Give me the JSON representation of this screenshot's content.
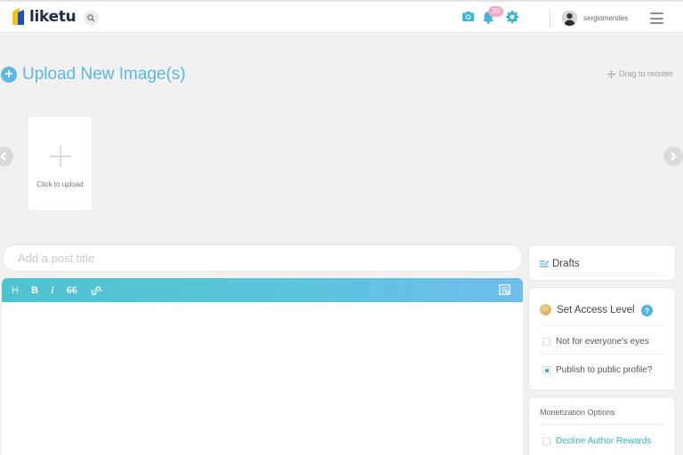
{
  "header": {
    "logo_text": "liketu",
    "notification_count": "30",
    "username": "sergiomendes"
  },
  "upload": {
    "title": "Upload New Image(s)",
    "drag_hint": "Drag to reorder",
    "tile_label": "Click to upload"
  },
  "post": {
    "title_placeholder": "Add a post title"
  },
  "toolbar": {
    "heading": "H",
    "bold": "B",
    "italic": "I",
    "quote": "66"
  },
  "sidebar": {
    "drafts_label": "Drafts",
    "access_title": "Set Access Level",
    "help_label": "?",
    "access_options": [
      {
        "label": "Not for everyone's eyes",
        "checked": false
      },
      {
        "label": "Publish to public profile?",
        "checked": true
      }
    ],
    "monetization_title": "Monetization Options",
    "monetization_options": [
      {
        "label": "Decline Author Rewards",
        "checked": false
      }
    ]
  },
  "colors": {
    "accent_blue": "#5bb7e6",
    "accent_teal": "#32b0c0",
    "brand_navy": "#1f2b45",
    "brand_yellow": "#f3c21b",
    "badge_pink": "#f4a7c4"
  },
  "icons": [
    "search-icon",
    "camera-icon",
    "bell-icon",
    "gear-icon",
    "menu-icon",
    "plus-circle-icon",
    "move-icon",
    "chevron-left-icon",
    "chevron-right-icon",
    "link-icon",
    "preview-icon",
    "drafts-icon",
    "coin-icon",
    "help-icon"
  ]
}
